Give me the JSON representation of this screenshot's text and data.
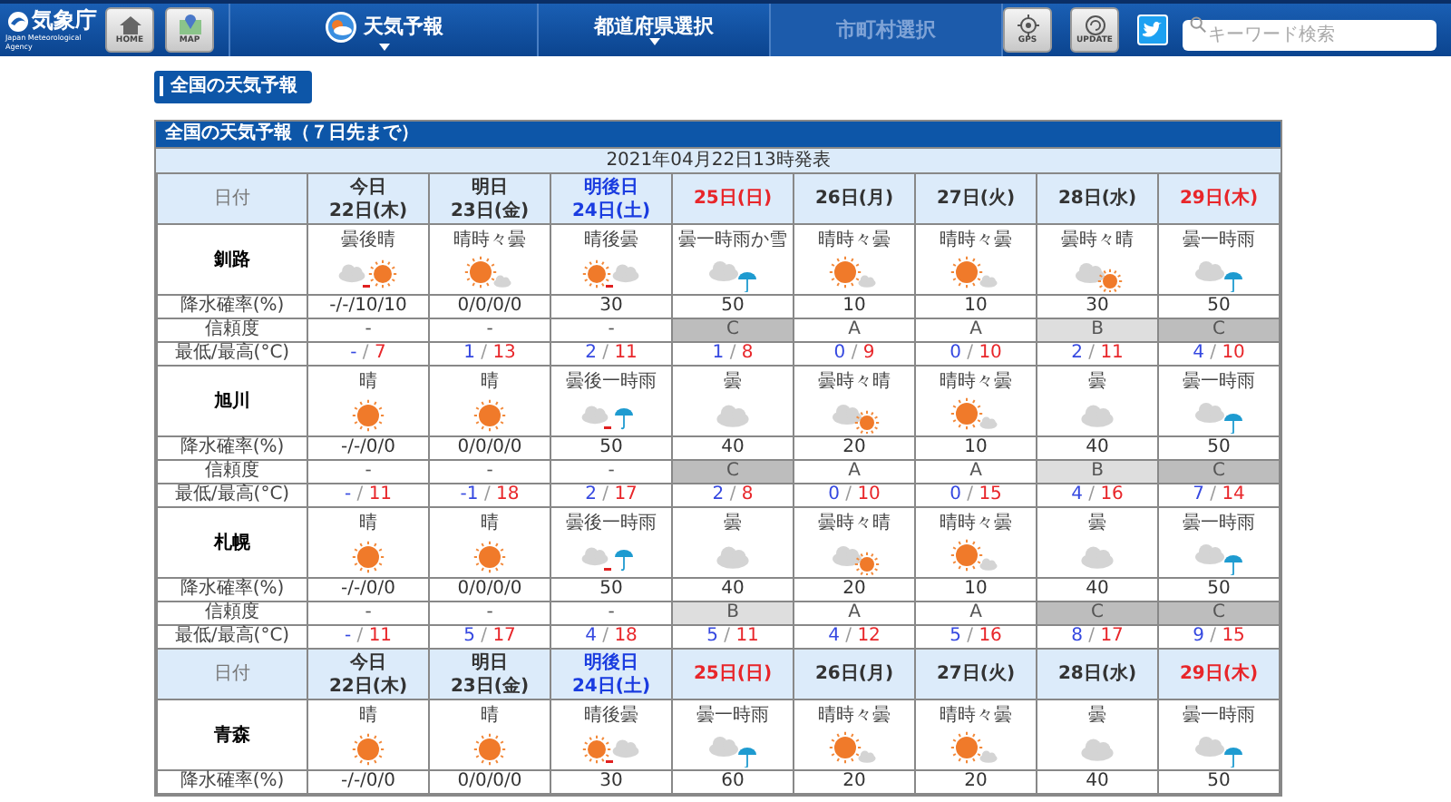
{
  "header": {
    "logo": {
      "name": "気象庁",
      "subtitle": "Japan Meteorological Agency"
    },
    "left_buttons": [
      {
        "label": "HOME",
        "kind": "home"
      },
      {
        "label": "MAP",
        "kind": "map"
      }
    ],
    "nav": [
      {
        "label": "天気予報",
        "kind": "weather",
        "disabled": false,
        "dropdown": true
      },
      {
        "label": "都道府県選択",
        "kind": "plain",
        "disabled": false,
        "dropdown": true
      },
      {
        "label": "市町村選択",
        "kind": "plain",
        "disabled": true,
        "dropdown": false
      }
    ],
    "right_buttons": [
      {
        "label": "GPS",
        "kind": "gps"
      },
      {
        "label": "UPDATE",
        "kind": "update"
      }
    ],
    "search": {
      "placeholder": "キーワード検索"
    }
  },
  "page_heading": "全国の天気予報",
  "table": {
    "title": "全国の天気予報（７日先まで）",
    "issued": "2021年04月22日13時発表",
    "sections": [
      {
        "kind": "dates",
        "label": "日付",
        "days": [
          {
            "line1": "今日",
            "line2": "22日(木)",
            "kind": "weekday"
          },
          {
            "line1": "明日",
            "line2": "23日(金)",
            "kind": "weekday"
          },
          {
            "line1": "明後日",
            "line2": "24日(土)",
            "kind": "saturday"
          },
          {
            "line1": "25日(日)",
            "kind": "holiday"
          },
          {
            "line1": "26日(月)",
            "kind": "weekday"
          },
          {
            "line1": "27日(火)",
            "kind": "weekday"
          },
          {
            "line1": "28日(水)",
            "kind": "weekday"
          },
          {
            "line1": "29日(木)",
            "kind": "holiday"
          }
        ]
      },
      {
        "kind": "region",
        "name": "釧路",
        "forecasts": [
          {
            "text": "曇後晴",
            "kind": "cloud_then_sun"
          },
          {
            "text": "晴時々曇",
            "kind": "sun_cloud"
          },
          {
            "text": "晴後曇",
            "kind": "sun_then_cloud"
          },
          {
            "text": "曇一時雨か雪",
            "kind": "cloud_rain"
          },
          {
            "text": "晴時々曇",
            "kind": "sun_cloud"
          },
          {
            "text": "晴時々曇",
            "kind": "sun_cloud"
          },
          {
            "text": "曇時々晴",
            "kind": "cloud_sun"
          },
          {
            "text": "曇一時雨",
            "kind": "cloud_rain"
          }
        ],
        "rows": [
          {
            "kind": "pop",
            "label": "降水確率(%)",
            "values": [
              "-/-/10/10",
              "0/0/0/0",
              "30",
              "50",
              "10",
              "10",
              "30",
              "50"
            ]
          },
          {
            "kind": "reliability",
            "label": "信頼度",
            "values": [
              {
                "grade": "-",
                "kind": "none"
              },
              {
                "grade": "-",
                "kind": "none"
              },
              {
                "grade": "-",
                "kind": "none"
              },
              {
                "grade": "C",
                "kind": "dark"
              },
              {
                "grade": "A",
                "kind": "none"
              },
              {
                "grade": "A",
                "kind": "none"
              },
              {
                "grade": "B",
                "kind": "light"
              },
              {
                "grade": "C",
                "kind": "dark"
              }
            ]
          },
          {
            "kind": "temps",
            "label": "最低/最高(°C)",
            "values": [
              {
                "min": "-",
                "separator": "/",
                "max": "7"
              },
              {
                "min": "1",
                "separator": "/",
                "max": "13"
              },
              {
                "min": "2",
                "separator": "/",
                "max": "11"
              },
              {
                "min": "1",
                "separator": "/",
                "max": "8"
              },
              {
                "min": "0",
                "separator": "/",
                "max": "9"
              },
              {
                "min": "0",
                "separator": "/",
                "max": "10"
              },
              {
                "min": "2",
                "separator": "/",
                "max": "11"
              },
              {
                "min": "4",
                "separator": "/",
                "max": "10"
              }
            ]
          }
        ]
      },
      {
        "kind": "region",
        "name": "旭川",
        "forecasts": [
          {
            "text": "晴",
            "kind": "sun"
          },
          {
            "text": "晴",
            "kind": "sun"
          },
          {
            "text": "曇後一時雨",
            "kind": "cloud_then_rain"
          },
          {
            "text": "曇",
            "kind": "cloud"
          },
          {
            "text": "曇時々晴",
            "kind": "cloud_sun"
          },
          {
            "text": "晴時々曇",
            "kind": "sun_cloud"
          },
          {
            "text": "曇",
            "kind": "cloud"
          },
          {
            "text": "曇一時雨",
            "kind": "cloud_rain"
          }
        ],
        "rows": [
          {
            "kind": "pop",
            "label": "降水確率(%)",
            "values": [
              "-/-/0/0",
              "0/0/0/0",
              "50",
              "40",
              "20",
              "10",
              "40",
              "50"
            ]
          },
          {
            "kind": "reliability",
            "label": "信頼度",
            "values": [
              {
                "grade": "-",
                "kind": "none"
              },
              {
                "grade": "-",
                "kind": "none"
              },
              {
                "grade": "-",
                "kind": "none"
              },
              {
                "grade": "C",
                "kind": "dark"
              },
              {
                "grade": "A",
                "kind": "none"
              },
              {
                "grade": "A",
                "kind": "none"
              },
              {
                "grade": "B",
                "kind": "light"
              },
              {
                "grade": "C",
                "kind": "dark"
              }
            ]
          },
          {
            "kind": "temps",
            "label": "最低/最高(°C)",
            "values": [
              {
                "min": "-",
                "separator": "/",
                "max": "11"
              },
              {
                "min": "-1",
                "separator": "/",
                "max": "18"
              },
              {
                "min": "2",
                "separator": "/",
                "max": "17"
              },
              {
                "min": "2",
                "separator": "/",
                "max": "8"
              },
              {
                "min": "0",
                "separator": "/",
                "max": "10"
              },
              {
                "min": "0",
                "separator": "/",
                "max": "15"
              },
              {
                "min": "4",
                "separator": "/",
                "max": "16"
              },
              {
                "min": "7",
                "separator": "/",
                "max": "14"
              }
            ]
          }
        ]
      },
      {
        "kind": "region",
        "name": "札幌",
        "forecasts": [
          {
            "text": "晴",
            "kind": "sun"
          },
          {
            "text": "晴",
            "kind": "sun"
          },
          {
            "text": "曇後一時雨",
            "kind": "cloud_then_rain"
          },
          {
            "text": "曇",
            "kind": "cloud"
          },
          {
            "text": "曇時々晴",
            "kind": "cloud_sun"
          },
          {
            "text": "晴時々曇",
            "kind": "sun_cloud"
          },
          {
            "text": "曇",
            "kind": "cloud"
          },
          {
            "text": "曇一時雨",
            "kind": "cloud_rain"
          }
        ],
        "rows": [
          {
            "kind": "pop",
            "label": "降水確率(%)",
            "values": [
              "-/-/0/0",
              "0/0/0/0",
              "50",
              "40",
              "20",
              "10",
              "40",
              "50"
            ]
          },
          {
            "kind": "reliability",
            "label": "信頼度",
            "values": [
              {
                "grade": "-",
                "kind": "none"
              },
              {
                "grade": "-",
                "kind": "none"
              },
              {
                "grade": "-",
                "kind": "none"
              },
              {
                "grade": "B",
                "kind": "light"
              },
              {
                "grade": "A",
                "kind": "none"
              },
              {
                "grade": "A",
                "kind": "none"
              },
              {
                "grade": "C",
                "kind": "dark"
              },
              {
                "grade": "C",
                "kind": "dark"
              }
            ]
          },
          {
            "kind": "temps",
            "label": "最低/最高(°C)",
            "values": [
              {
                "min": "-",
                "separator": "/",
                "max": "11"
              },
              {
                "min": "5",
                "separator": "/",
                "max": "17"
              },
              {
                "min": "4",
                "separator": "/",
                "max": "18"
              },
              {
                "min": "5",
                "separator": "/",
                "max": "11"
              },
              {
                "min": "4",
                "separator": "/",
                "max": "12"
              },
              {
                "min": "5",
                "separator": "/",
                "max": "16"
              },
              {
                "min": "8",
                "separator": "/",
                "max": "17"
              },
              {
                "min": "9",
                "separator": "/",
                "max": "15"
              }
            ]
          }
        ]
      },
      {
        "kind": "dates",
        "label": "日付",
        "days": [
          {
            "line1": "今日",
            "line2": "22日(木)",
            "kind": "weekday"
          },
          {
            "line1": "明日",
            "line2": "23日(金)",
            "kind": "weekday"
          },
          {
            "line1": "明後日",
            "line2": "24日(土)",
            "kind": "saturday"
          },
          {
            "line1": "25日(日)",
            "kind": "holiday"
          },
          {
            "line1": "26日(月)",
            "kind": "weekday"
          },
          {
            "line1": "27日(火)",
            "kind": "weekday"
          },
          {
            "line1": "28日(水)",
            "kind": "weekday"
          },
          {
            "line1": "29日(木)",
            "kind": "holiday"
          }
        ]
      },
      {
        "kind": "region",
        "name": "青森",
        "forecasts": [
          {
            "text": "晴",
            "kind": "sun"
          },
          {
            "text": "晴",
            "kind": "sun"
          },
          {
            "text": "晴後曇",
            "kind": "sun_then_cloud"
          },
          {
            "text": "曇一時雨",
            "kind": "cloud_rain"
          },
          {
            "text": "晴時々曇",
            "kind": "sun_cloud"
          },
          {
            "text": "晴時々曇",
            "kind": "sun_cloud"
          },
          {
            "text": "曇",
            "kind": "cloud"
          },
          {
            "text": "曇一時雨",
            "kind": "cloud_rain"
          }
        ],
        "rows": [
          {
            "kind": "pop",
            "label": "降水確率(%)",
            "values": [
              "-/-/0/0",
              "0/0/0/0",
              "30",
              "60",
              "20",
              "20",
              "40",
              "50"
            ]
          }
        ]
      }
    ]
  }
}
